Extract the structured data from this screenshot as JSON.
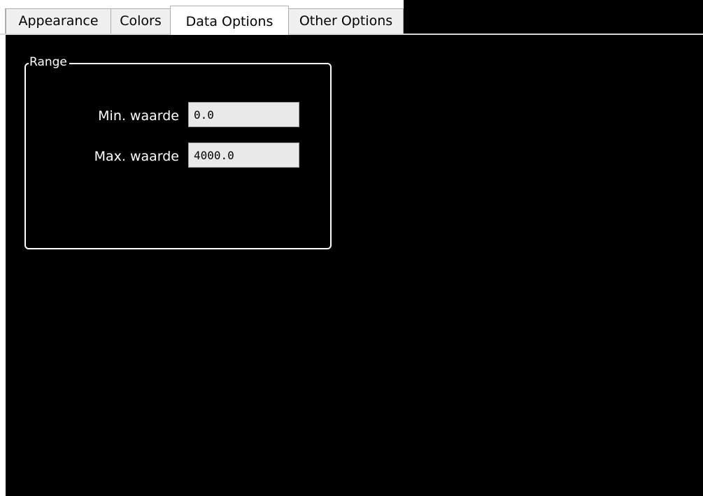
{
  "tabs": [
    {
      "label": "Appearance",
      "active": false
    },
    {
      "label": "Colors",
      "active": false
    },
    {
      "label": "Data Options",
      "active": true
    },
    {
      "label": "Other Options",
      "active": false
    }
  ],
  "range_group": {
    "title": "Range",
    "min": {
      "label": "Min. waarde",
      "value": "0.0"
    },
    "max": {
      "label": "Max. waarde",
      "value": "4000.0"
    }
  },
  "colors": {
    "panel_background": "#000000",
    "group_border": "#ffffff",
    "input_background": "#e9e9e9"
  }
}
